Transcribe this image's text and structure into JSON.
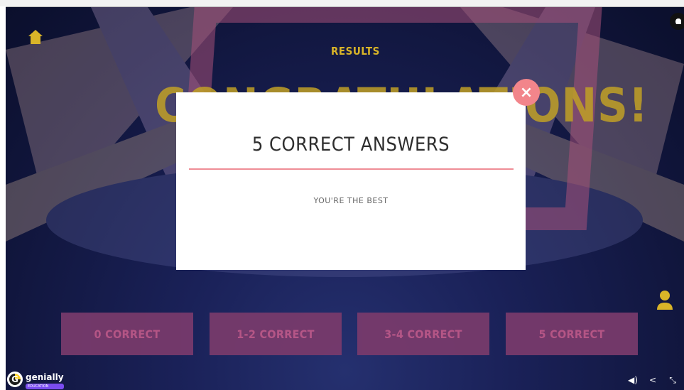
{
  "scene": {
    "header_label": "RESULTS",
    "background_headline": "CONGRATULATIONS!",
    "colors": {
      "accent_gold": "#d9b428",
      "frame_pink": "#a55178",
      "button_bg": "#7a3b6c",
      "button_text": "#c25a8a",
      "close_bg": "#f2858b",
      "rule": "#ef8d96"
    }
  },
  "modal": {
    "title": "5 CORRECT ANSWERS",
    "subtitle": "YOU'RE THE BEST",
    "close_symbol": "×"
  },
  "result_buttons": [
    {
      "label": "0 CORRECT"
    },
    {
      "label": "1-2 CORRECT"
    },
    {
      "label": "3-4 CORRECT"
    },
    {
      "label": "5 CORRECT"
    }
  ],
  "icons": {
    "home": "home-icon",
    "user": "user-icon",
    "hand": "hand-icon",
    "sound": "sound-icon",
    "share": "share-icon",
    "fullscreen": "collapse-icon"
  },
  "branding": {
    "logo_text": "genially",
    "logo_badge": "EDUCATION",
    "logo_letter": "G"
  },
  "controls": {
    "sound_symbol": "◀)",
    "share_symbol": "<",
    "collapse_symbol": "⤡"
  }
}
